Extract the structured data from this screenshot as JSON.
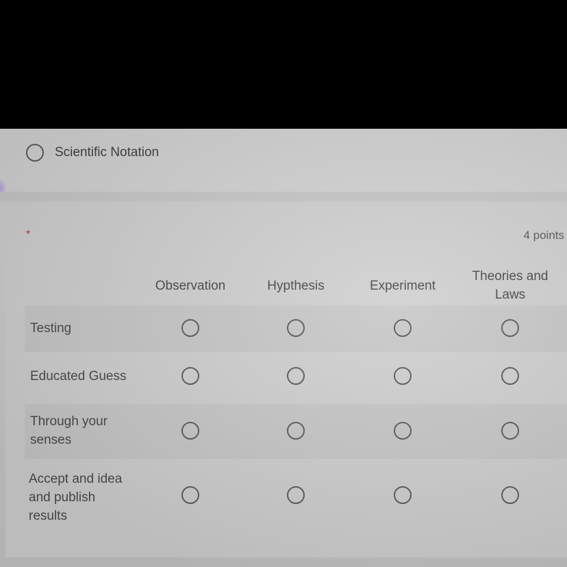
{
  "previous_question": {
    "option_label": "Scientific Notation"
  },
  "question": {
    "required_marker": "*",
    "points_label": "4 points",
    "columns": [
      "Observation",
      "Hypthesis",
      "Experiment",
      "Theories and Laws"
    ],
    "rows": [
      "Testing",
      "Educated Guess",
      "Through your senses",
      "Accept and idea and publish results"
    ]
  }
}
